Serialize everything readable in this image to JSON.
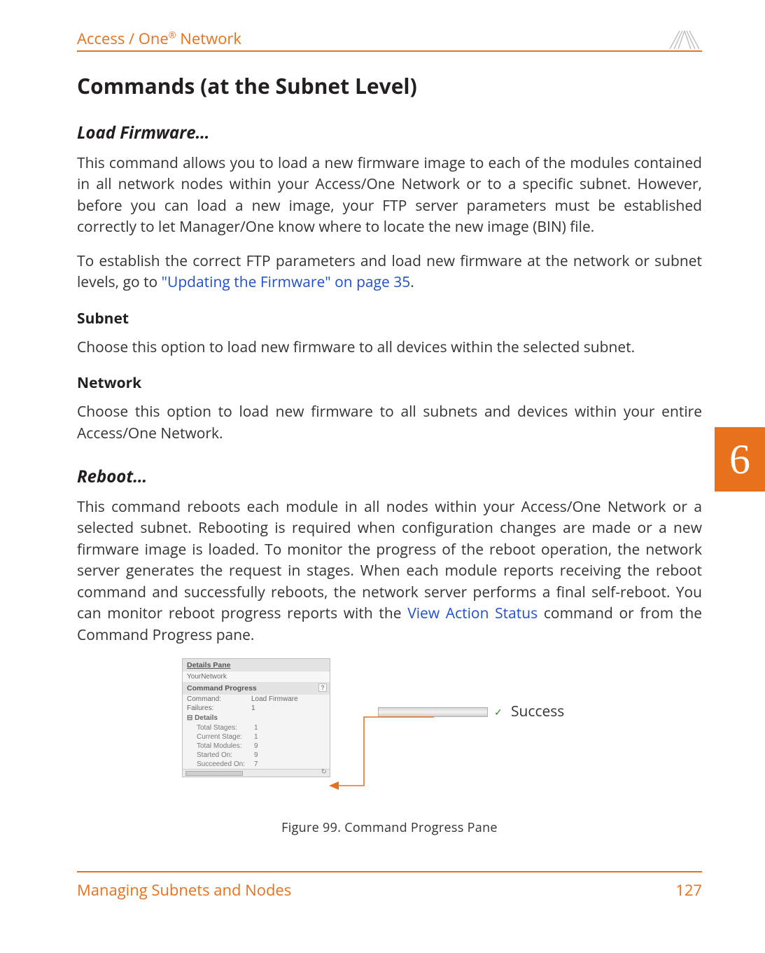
{
  "header": {
    "title_prefix": "Access / One",
    "title_sup": "®",
    "title_suffix": " Network"
  },
  "side_tab": "6",
  "sections": {
    "h1": "Commands (at the Subnet Level)",
    "load_firmware": {
      "heading": "Load Firmware…",
      "p1": "This command allows you to load a new firmware image to each of the modules contained in all network nodes within your Access/One Network or to a specific subnet. However, before you can load a new image, your FTP server parameters must be established correctly to let Manager/One know where to locate the new image (BIN) file.",
      "p2a": "To establish the correct FTP parameters and load new firmware at the network or subnet levels, go to ",
      "p2_link": "\"Updating the Firmware\" on page 35",
      "p2b": "."
    },
    "subnet": {
      "heading": "Subnet",
      "p": "Choose this option to load new firmware to all devices within the selected subnet."
    },
    "network": {
      "heading": "Network",
      "p": "Choose this option to load new firmware to all subnets and devices within your entire Access/One Network."
    },
    "reboot": {
      "heading": "Reboot…",
      "p_a": "This command reboots each module in all nodes within your Access/One Network or a selected subnet. Rebooting is required when configuration changes are made or a new firmware image is loaded. To monitor the progress of the reboot operation, the network server generates the request in stages. When each module reports receiving the reboot command and successfully reboots, the network server performs a final self-reboot. You can monitor reboot progress reports with the ",
      "p_link": "View Action Status",
      "p_b": " command or from the Command Progress pane."
    }
  },
  "figure": {
    "pane_title": "Details Pane",
    "network_name": "YourNetwork",
    "cmd_head": "Command Progress",
    "rows": {
      "command_lbl": "Command:",
      "command_val": "Load Firmware",
      "failures_lbl": "Failures:",
      "failures_val": "1",
      "details_lbl": "Details",
      "total_stages_lbl": "Total Stages:",
      "total_stages_val": "1",
      "current_stage_lbl": "Current Stage:",
      "current_stage_val": "1",
      "total_modules_lbl": "Total Modules:",
      "total_modules_val": "9",
      "started_on_lbl": "Started On:",
      "started_on_val": "9",
      "succeeded_on_lbl": "Succeeded On:",
      "succeeded_on_val": "7"
    },
    "success_label": "Success",
    "caption": "Figure 99. Command Progress Pane"
  },
  "footer": {
    "left": "Managing Subnets and Nodes",
    "right": "127"
  }
}
